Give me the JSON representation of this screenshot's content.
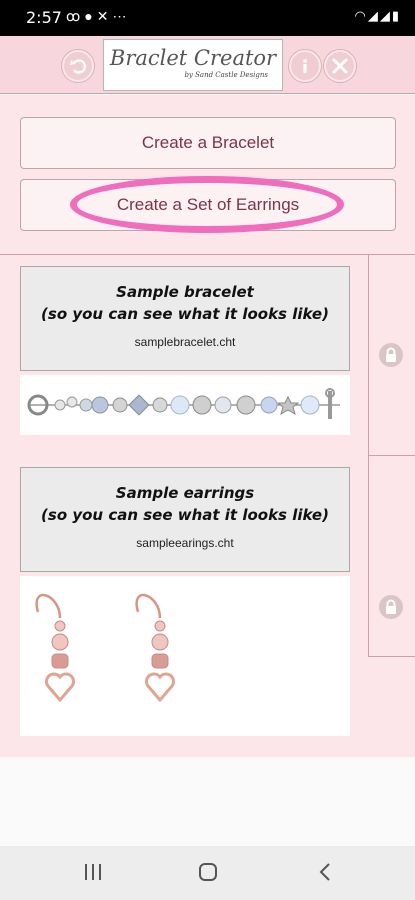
{
  "status_bar": {
    "time": "2:57",
    "left_icons": [
      "voicemail-icon",
      "account-icon",
      "tools-icon",
      "more-icon"
    ],
    "right_icons": [
      "wifi-icon",
      "signal-icon",
      "signal-icon",
      "battery-icon"
    ]
  },
  "header": {
    "logo_title": "Braclet Creator",
    "logo_subtitle": "by Sand Castle Designs"
  },
  "create": {
    "bracelet_label": "Create a Bracelet",
    "earrings_label": "Create a Set of Earrings"
  },
  "items": [
    {
      "name_line1": "Sample bracelet",
      "name_line2": "(so you can see what it looks like)",
      "file": "samplebracelet.cht"
    },
    {
      "name_line1": "Sample earrings",
      "name_line2": "(so you can see what it looks like)",
      "file": "sampleearings.cht"
    }
  ],
  "colors": {
    "header_bg": "#f7d7dd",
    "panel_bg": "#fce6ea",
    "button_text": "#7b3547",
    "highlight": "#f06cbd"
  }
}
